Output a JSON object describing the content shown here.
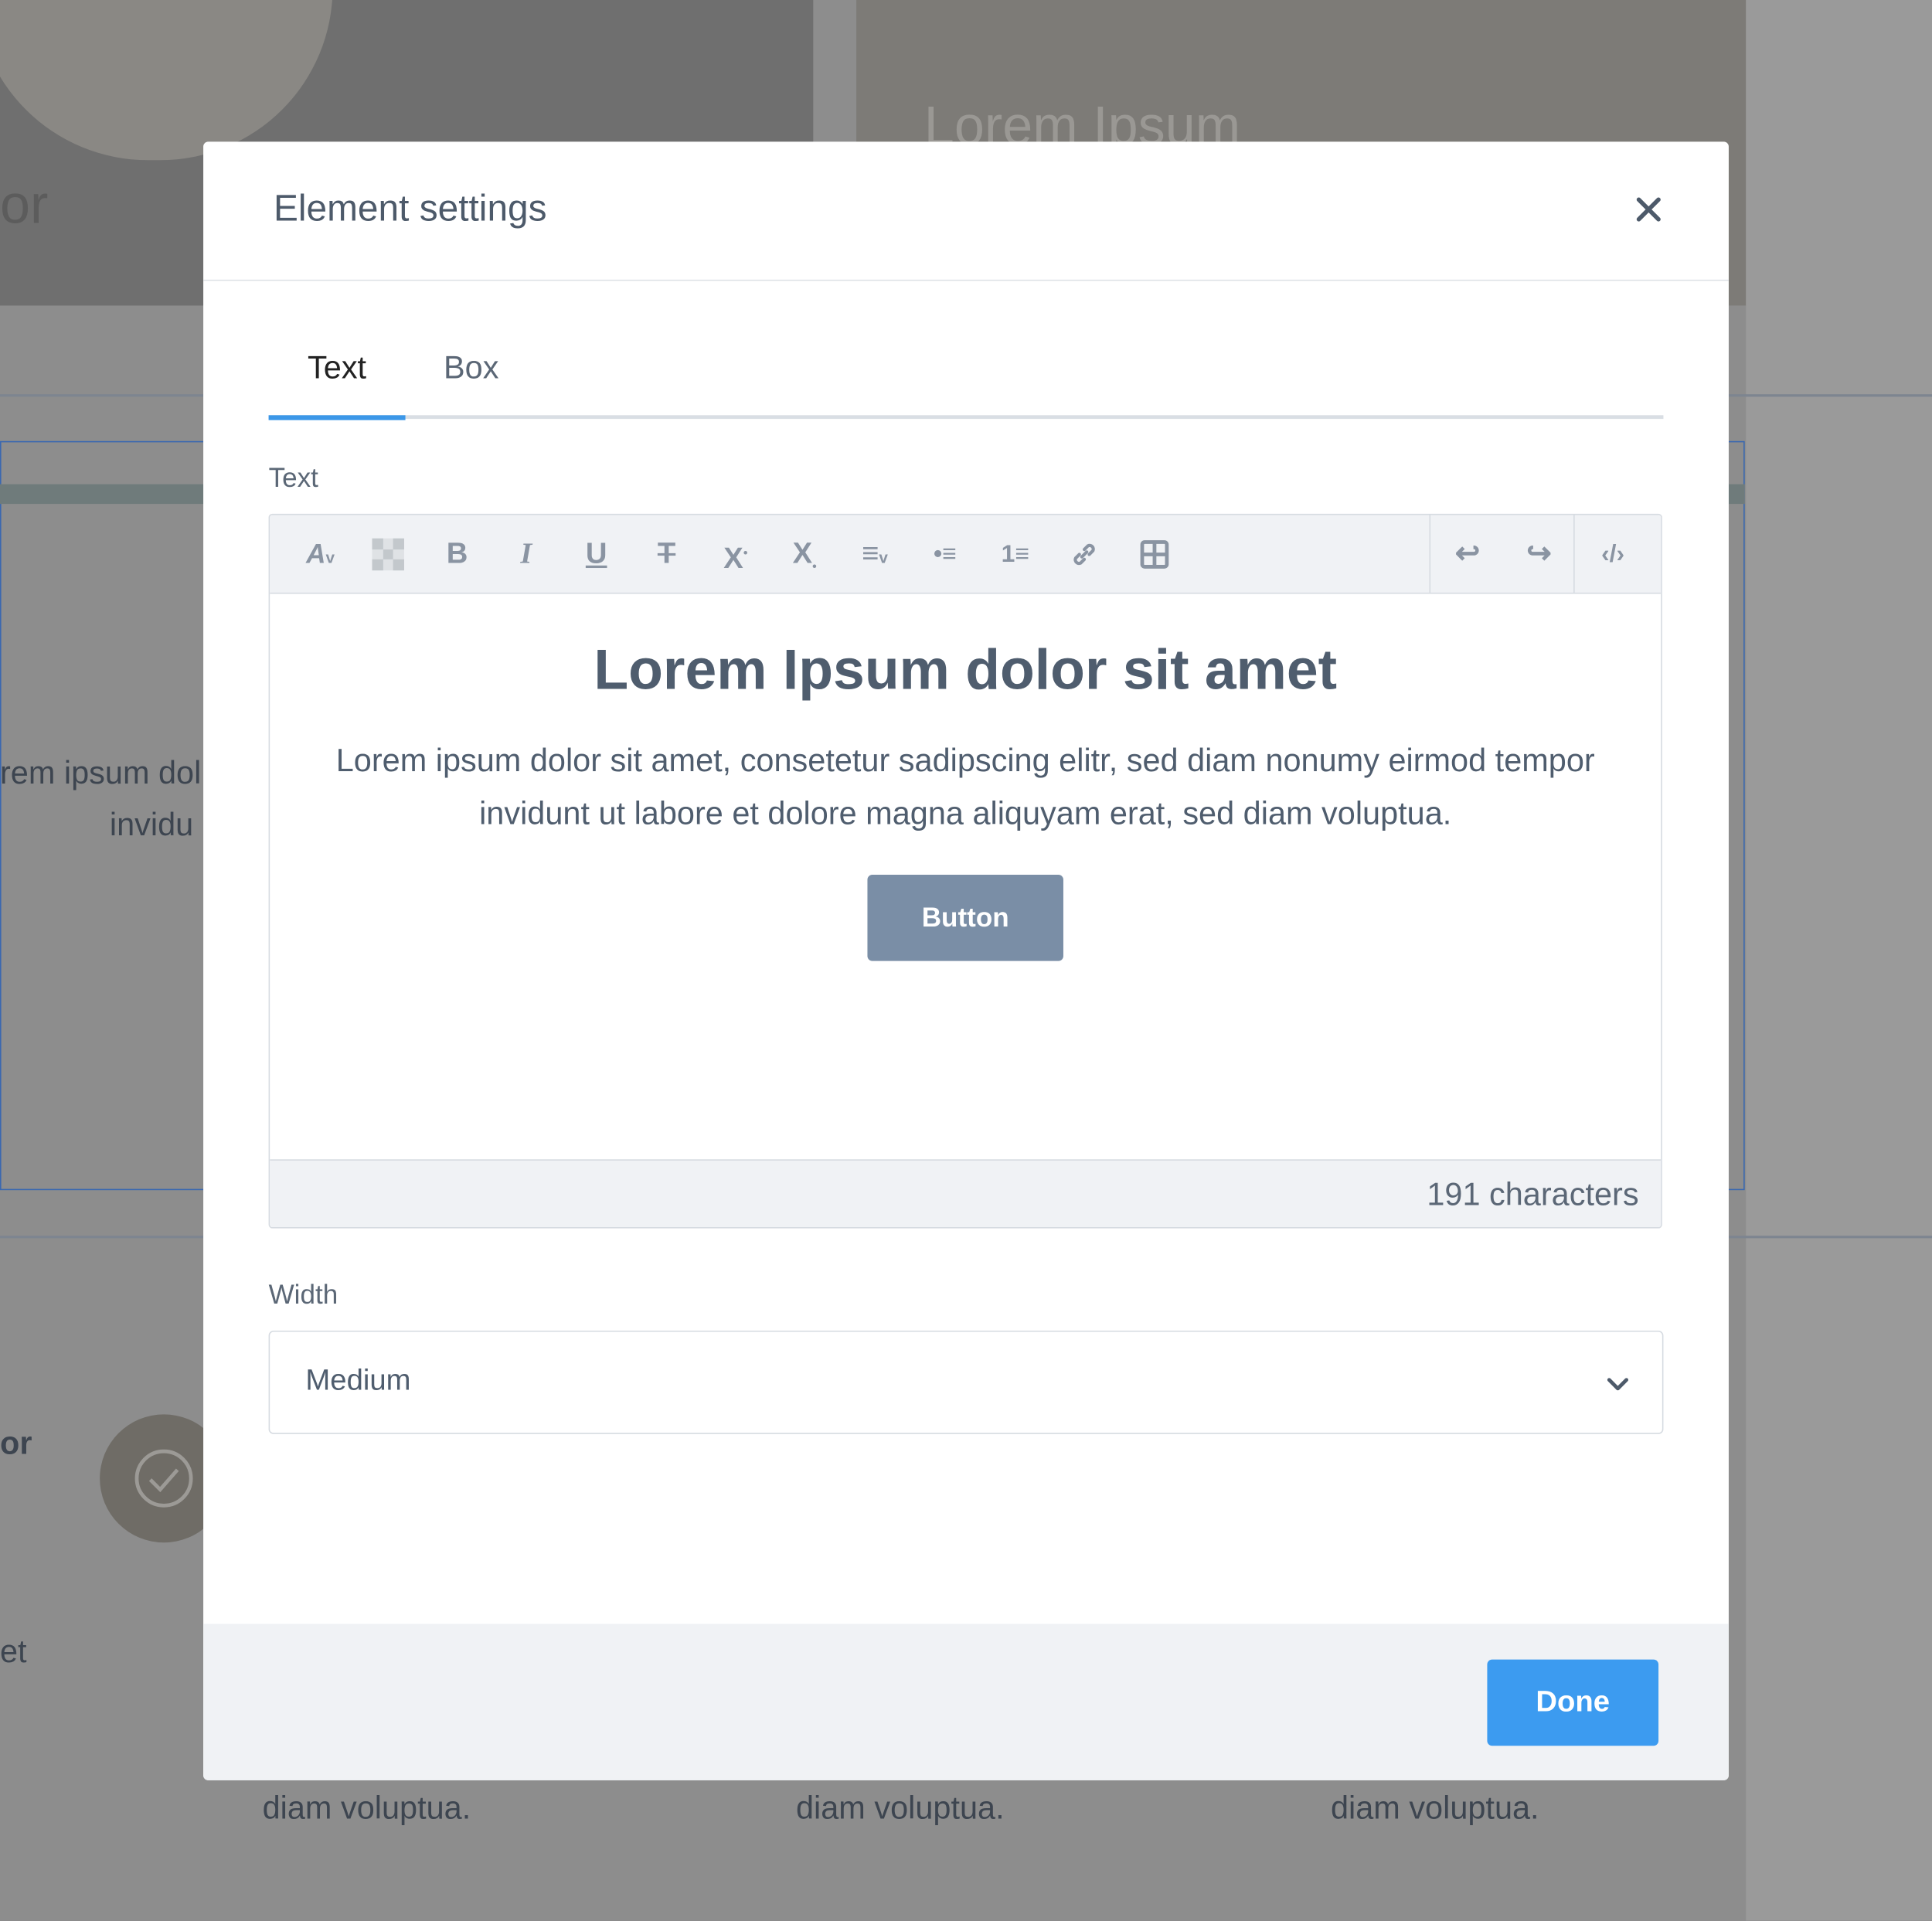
{
  "background": {
    "card_title": "Lorem Ipsum",
    "fragment_left_top": "or",
    "fragment_body_1": "rem ipsum dol",
    "fragment_body_2": "invidu",
    "fragment_left_mid": "or",
    "fragment_left_low": "et",
    "repeated_text": [
      "diam voluptua.",
      "diam voluptua.",
      "diam voluptua."
    ]
  },
  "modal": {
    "title": "Element settings",
    "tabs": [
      {
        "label": "Text",
        "active": true
      },
      {
        "label": "Box",
        "active": false
      }
    ],
    "text_label": "Text",
    "toolbar": [
      "font-size-icon",
      "background-color-icon",
      "bold-icon",
      "italic-icon",
      "underline-icon",
      "strikethrough-icon",
      "superscript-icon",
      "subscript-icon",
      "align-icon",
      "bullet-list-icon",
      "numbered-list-icon",
      "link-icon",
      "table-icon",
      "undo-icon",
      "redo-icon",
      "code-view-icon"
    ],
    "editor": {
      "heading": "Lorem Ipsum dolor sit amet",
      "paragraph": "Lorem ipsum dolor sit amet, consetetur sadipscing elitr, sed diam nonumy eirmod tempor invidunt ut labore et dolore magna aliquyam erat, sed diam voluptua.",
      "button_label": "Button",
      "char_count": "191 characters"
    },
    "width_label": "Width",
    "width_value": "Medium",
    "done_label": "Done"
  },
  "colors": {
    "accent": "#3c9bf0",
    "tab_underline": "#3b97e8",
    "inline_button": "#7a8ea6"
  }
}
